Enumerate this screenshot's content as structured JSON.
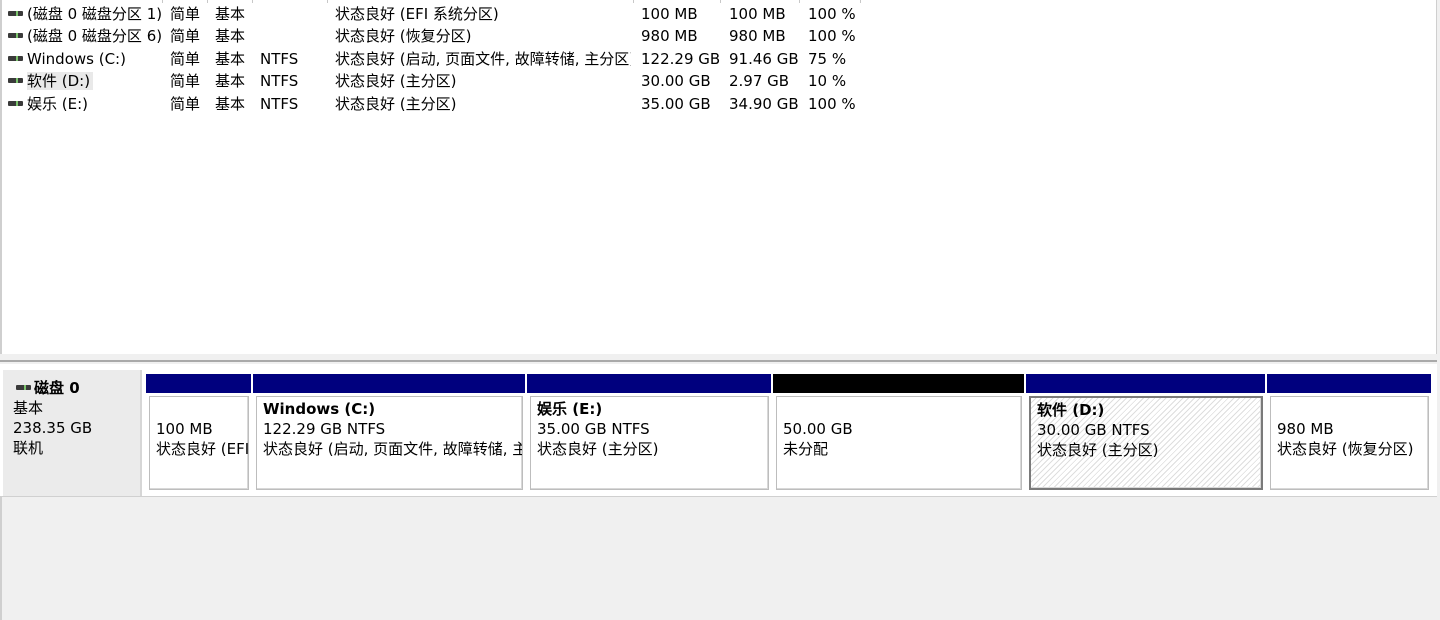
{
  "volumes": [
    {
      "name": "(磁盘 0 磁盘分区 1)",
      "layout": "简单",
      "type": "基本",
      "fs": "",
      "status": "状态良好 (EFI 系统分区)",
      "capacity": "100 MB",
      "free": "100 MB",
      "pct": "100 %"
    },
    {
      "name": "(磁盘 0 磁盘分区 6)",
      "layout": "简单",
      "type": "基本",
      "fs": "",
      "status": "状态良好 (恢复分区)",
      "capacity": "980 MB",
      "free": "980 MB",
      "pct": "100 %"
    },
    {
      "name": "Windows (C:)",
      "layout": "简单",
      "type": "基本",
      "fs": "NTFS",
      "status": "状态良好 (启动, 页面文件, 故障转储, 主分区)",
      "capacity": "122.29 GB",
      "free": "91.46 GB",
      "pct": "75 %"
    },
    {
      "name": "软件 (D:)",
      "layout": "简单",
      "type": "基本",
      "fs": "NTFS",
      "status": "状态良好 (主分区)",
      "capacity": "30.00 GB",
      "free": "2.97 GB",
      "pct": "10 %"
    },
    {
      "name": "娱乐 (E:)",
      "layout": "简单",
      "type": "基本",
      "fs": "NTFS",
      "status": "状态良好 (主分区)",
      "capacity": "35.00 GB",
      "free": "34.90 GB",
      "pct": "100 %"
    }
  ],
  "disk": {
    "title": "磁盘 0",
    "type": "基本",
    "size": "238.35 GB",
    "state": "联机"
  },
  "partitions": [
    {
      "title": "",
      "size": "100 MB",
      "status": "状态良好 (EFI"
    },
    {
      "title": "Windows  (C:)",
      "size": "122.29 GB NTFS",
      "status": "状态良好 (启动, 页面文件, 故障转储, 主"
    },
    {
      "title": "娱乐  (E:)",
      "size": "35.00 GB NTFS",
      "status": "状态良好 (主分区)"
    },
    {
      "title": "",
      "size": "50.00 GB",
      "status": "未分配"
    },
    {
      "title": "软件  (D:)",
      "size": "30.00 GB NTFS",
      "status": "状态良好 (主分区)"
    },
    {
      "title": "",
      "size": "980 MB",
      "status": "状态良好 (恢复分区)"
    }
  ],
  "icons": {
    "volume": "drive-icon",
    "disk": "drive-icon"
  },
  "colors": {
    "primary_partition_bar": "#00007e",
    "unallocated_bar": "#000000",
    "selected_hatch": "#dedede"
  }
}
